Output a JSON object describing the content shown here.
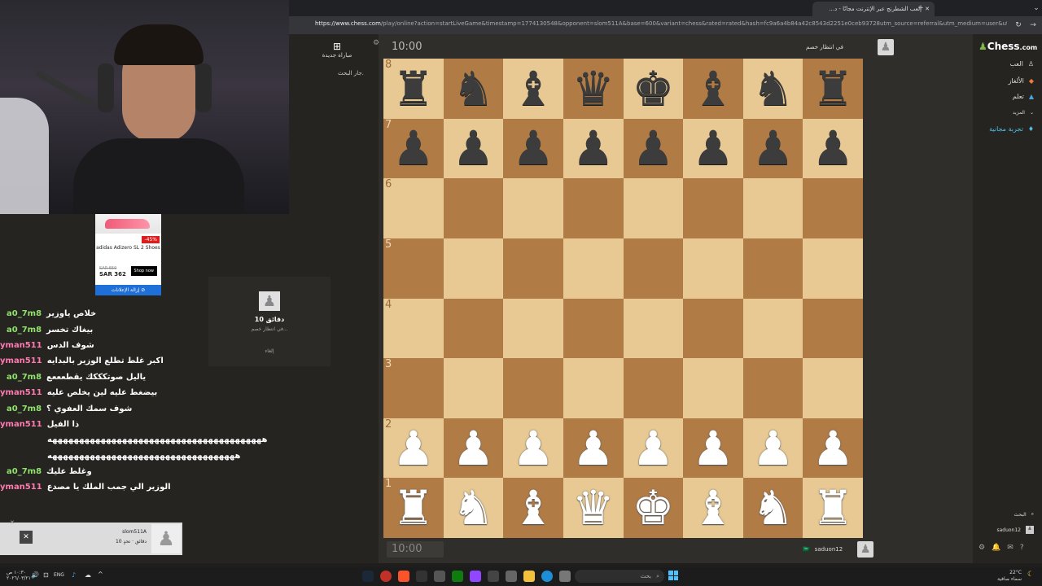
{
  "browser": {
    "tab_title": "إلعب الشطرنج عبر الإنترنت مجانًا - د...",
    "url_domain": "https://www.chess.com",
    "url_path": "/play/online?action=startLiveGame&timestamp=1774130548&opponent=slom511A&base=600&variant=chess&rated=rated&hash=fc9a6a4b84a42c8543d2251e0ceb93728utm_source=referral&utm_medium=user&utm_campaign=challenge_invite"
  },
  "left_panel": {
    "new_game_label": "مباراة جديدة",
    "searching_label": "جار البحث."
  },
  "wait_card": {
    "time": "10 دقائق",
    "status": "في انتظار خصم...",
    "cancel": "إلغاء"
  },
  "board": {
    "ranks": [
      "8",
      "7",
      "6",
      "5",
      "4",
      "3",
      "2",
      "1"
    ],
    "pieces": [
      [
        "♜",
        "♞",
        "♝",
        "♛",
        "♚",
        "♝",
        "♞",
        "♜"
      ],
      [
        "♟",
        "♟",
        "♟",
        "♟",
        "♟",
        "♟",
        "♟",
        "♟"
      ],
      [
        "",
        "",
        "",
        "",
        "",
        "",
        "",
        ""
      ],
      [
        "",
        "",
        "",
        "",
        "",
        "",
        "",
        ""
      ],
      [
        "",
        "",
        "",
        "",
        "",
        "",
        "",
        ""
      ],
      [
        "",
        "",
        "",
        "",
        "",
        "",
        "",
        ""
      ],
      [
        "♟",
        "♟",
        "♟",
        "♟",
        "♟",
        "♟",
        "♟",
        "♟"
      ],
      [
        "♜",
        "♞",
        "♝",
        "♛",
        "♚",
        "♝",
        "♞",
        "♜"
      ]
    ],
    "top_clock": "10:00",
    "bottom_clock": "10:00",
    "top_player": "في انتظار خصم",
    "bottom_player": "saduon12",
    "bottom_flag": "🇸🇦"
  },
  "ad": {
    "badge": "-45%",
    "product": "adidas Adizero SL 2 Shoes",
    "old_price": "SAR 659",
    "price": "SAR 362",
    "cta": "Shop now",
    "remove": "إزالة الإعلانات"
  },
  "chat": [
    {
      "user": "a0_7m8",
      "msg": "خلاص ياوزير",
      "color": "#8fe36a"
    },
    {
      "user": "a0_7m8",
      "msg": "بيغاك تخسر",
      "color": "#8fe36a"
    },
    {
      "user": "yman511",
      "msg": "شوف الدس",
      "color": "#ff7ab0"
    },
    {
      "user": "yman511",
      "msg": "اكبر غلط تطلع الوزير بالبدايه",
      "color": "#ff7ab0"
    },
    {
      "user": "a0_7m8",
      "msg": "ياليل صوتكككك يقطعععع",
      "color": "#8fe36a"
    },
    {
      "user": "yman511",
      "msg": "بيضغط عليه لين يخلص عليه",
      "color": "#ff7ab0"
    },
    {
      "user": "a0_7m8",
      "msg": "شوف سمك العفوي ؟",
      "color": "#8fe36a"
    },
    {
      "user": "yman511",
      "msg": "ذا الفيل",
      "color": "#ff7ab0"
    },
    {
      "user": "",
      "msg": "ههههههههههههههههههههههههههههههههههههههههه",
      "color": "#fff"
    },
    {
      "user": "",
      "msg": "هههههههههههههههههههههههههههههههههههه",
      "color": "#fff"
    },
    {
      "user": "a0_7m8",
      "msg": "وغلط عليك",
      "color": "#8fe36a"
    },
    {
      "user": "yman511",
      "msg": "الوزير الي جمب الملك يا مصدع",
      "color": "#ff7ab0"
    }
  ],
  "right_nav": {
    "logo_main": "Chess",
    "logo_suffix": ".com",
    "items": [
      "العب",
      "الألغاز",
      "تعلم",
      "المزيد",
      "تجربة مجانية"
    ],
    "search": "البحث",
    "user": "saduon12"
  },
  "notification": {
    "user": "slom511A",
    "detail": "10 دقائق · تحدٍ"
  },
  "taskbar": {
    "lang": "ENG",
    "time": "١٠:٣٠ ص",
    "date": "٢٠٢٦/٠٣/٢١",
    "weather": "22°C",
    "weather_desc": "سماء صافية",
    "search": "بحث"
  }
}
